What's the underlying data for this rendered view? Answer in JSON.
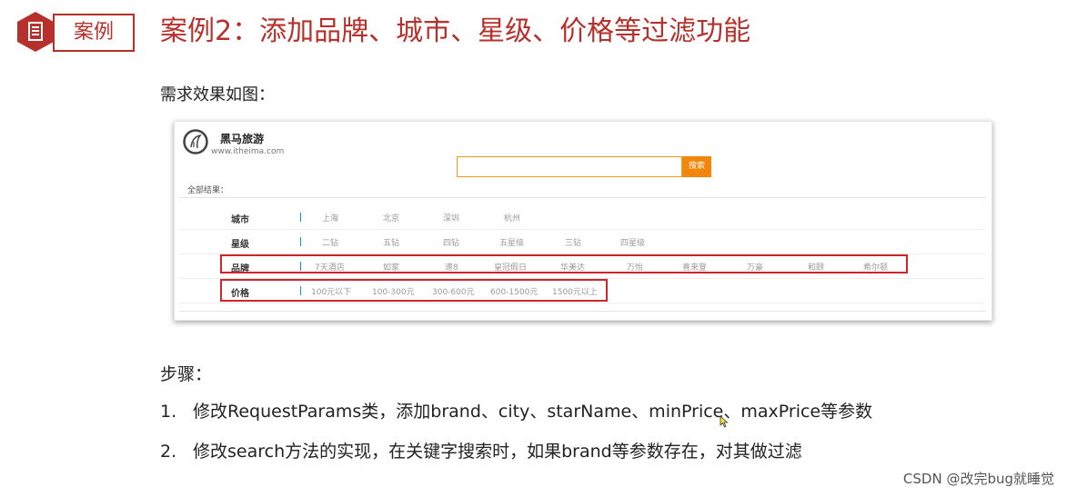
{
  "header": {
    "badge_label": "案例",
    "title": "案例2：添加品牌、城市、星级、价格等过滤功能",
    "accent": "#b6312b"
  },
  "intro": "需求效果如图：",
  "screenshot": {
    "logo_name": "黑马旅游",
    "logo_url": "www.itheima.com",
    "search_button": "搜索",
    "all_results": "全部结果：",
    "filters": [
      {
        "label": "城市",
        "options": [
          "上海",
          "北京",
          "深圳",
          "杭州"
        ]
      },
      {
        "label": "星级",
        "options": [
          "二钻",
          "五钻",
          "四钻",
          "五星级",
          "三钻",
          "四星级"
        ]
      },
      {
        "label": "品牌",
        "options": [
          "7天酒店",
          "如家",
          "速8",
          "皇冠假日",
          "华美达",
          "万怡",
          "喜来登",
          "万豪",
          "和颐",
          "希尔顿"
        ]
      },
      {
        "label": "价格",
        "options": [
          "100元以下",
          "100-300元",
          "300-600元",
          "600-1500元",
          "1500元以上"
        ]
      }
    ]
  },
  "steps": {
    "title": "步骤：",
    "items": [
      {
        "num": "1.",
        "text": "修改RequestParams类，添加brand、city、starName、minPrice、maxPrice等参数"
      },
      {
        "num": "2.",
        "text": "修改search方法的实现，在关键字搜索时，如果brand等参数存在，对其做过滤"
      }
    ]
  },
  "watermark": "CSDN @改完bug就睡觉"
}
